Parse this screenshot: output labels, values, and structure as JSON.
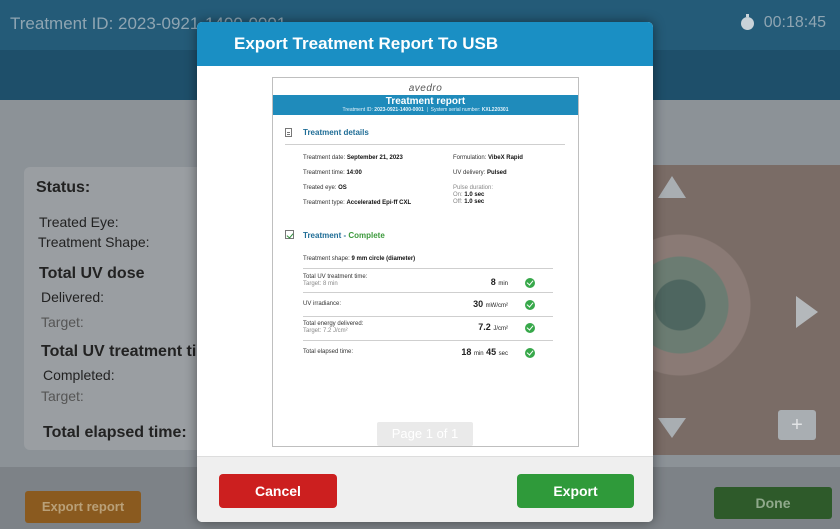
{
  "background": {
    "title": "Treatment ID: 2023-0921-1400-0001",
    "timer": "00:18:45",
    "status": {
      "heading": "Status:",
      "treated_eye": "Treated Eye:",
      "treatment_shape": "Treatment Shape:",
      "uv_dose_heading": "Total UV dose",
      "delivered": "Delivered:",
      "target": "Target:",
      "uv_time_heading": "Total UV treatment ti",
      "completed": "Completed:",
      "target2": "Target:",
      "elapsed_heading": "Total elapsed time:"
    },
    "plus": "+",
    "export_report": "Export report",
    "done": "Done"
  },
  "modal": {
    "title": "Export Treatment Report To USB",
    "cancel": "Cancel",
    "export": "Export",
    "page_indicator": "Page 1 of 1"
  },
  "report": {
    "logo": "avedro",
    "title": "Treatment report",
    "id_label": "Treatment ID:",
    "id_value": "2023-0921-1400-0001",
    "serial_label": "System serial number:",
    "serial_value": "KXL220301",
    "details_title": "Treatment details",
    "date_label": "Treatment date:",
    "date_value": "September 21, 2023",
    "time_label": "Treatment time:",
    "time_value": "14:00",
    "eye_label": "Treated eye:",
    "eye_value": "OS",
    "type_label": "Treatment type:",
    "type_value": "Accelerated Epi-ff CXL",
    "formulation_label": "Formulation:",
    "formulation_value": "VibeX Rapid",
    "uv_delivery_label": "UV delivery:",
    "uv_delivery_value": "Pulsed",
    "pulse_label": "Pulse duration:",
    "pulse_on_label": "On:",
    "pulse_on_value": "1.0 sec",
    "pulse_off_label": "Off:",
    "pulse_off_value": "1.0 sec",
    "treatment_title": "Treatment",
    "treatment_status": "Complete",
    "shape_label": "Treatment shape:",
    "shape_value": "9 mm circle (diameter)",
    "rows": [
      {
        "label": "Total UV treatment time:",
        "sub": "Target: 8 min",
        "value": "8",
        "unit": "min"
      },
      {
        "label": "UV irradiance:",
        "sub": "",
        "value": "30",
        "unit": "mW/cm²"
      },
      {
        "label": "Total energy delivered:",
        "sub": "Target: 7.2 J/cm²",
        "value": "7.2",
        "unit": "J/cm²"
      },
      {
        "label": "Total elapsed time:",
        "sub": "",
        "value": "18",
        "unit": "min",
        "value2": "45",
        "unit2": "sec"
      }
    ]
  }
}
